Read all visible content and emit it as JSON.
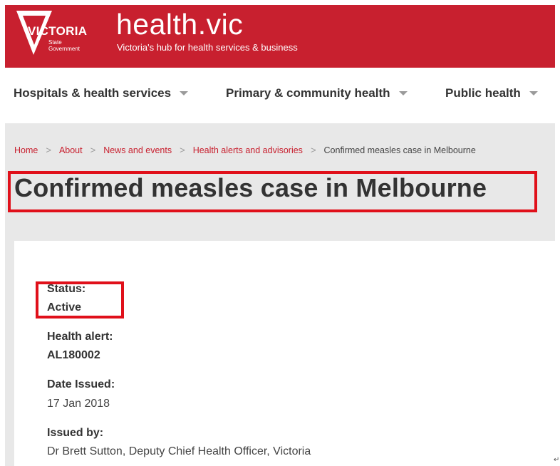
{
  "header": {
    "logo_word": "VICTORIA",
    "logo_sub_1": "State",
    "logo_sub_2": "Government",
    "site_title": "health.vic",
    "tagline": "Victoria's hub for health services & business",
    "brand_color": "#c8202f"
  },
  "nav": {
    "items": [
      {
        "label": "Hospitals & health services",
        "icon": "chevron-down-icon"
      },
      {
        "label": "Primary & community health",
        "icon": "chevron-down-icon"
      },
      {
        "label": "Public health",
        "icon": "chevron-down-icon"
      }
    ]
  },
  "breadcrumb": {
    "items": [
      "Home",
      "About",
      "News and events",
      "Health alerts and advisories"
    ],
    "current": "Confirmed measles case in Melbourne",
    "separator": ">"
  },
  "page": {
    "title": "Confirmed measles case in Melbourne"
  },
  "details": {
    "status_label": "Status:",
    "status_value": "Active",
    "alert_label": "Health alert:",
    "alert_value": "AL180002",
    "date_label": "Date Issued:",
    "date_value": "17 Jan 2018",
    "issuer_label": "Issued by:",
    "issuer_value": "Dr Brett Sutton, Deputy Chief Health Officer, Victoria"
  },
  "annotations": {
    "highlight_color": "#e0101a"
  }
}
